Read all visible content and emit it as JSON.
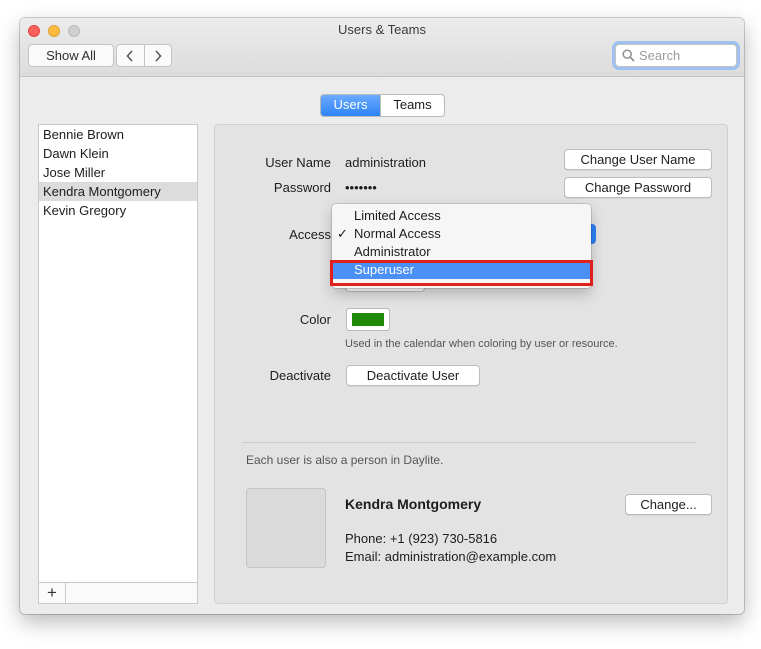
{
  "window": {
    "title": "Users & Teams"
  },
  "toolbar": {
    "show_all_label": "Show All",
    "back_icon": "chevron-left-icon",
    "forward_icon": "chevron-right-icon",
    "search_placeholder": "Search"
  },
  "tabs": [
    {
      "label": "Users",
      "selected": true
    },
    {
      "label": "Teams",
      "selected": false
    }
  ],
  "users": [
    {
      "name": "Bennie Brown"
    },
    {
      "name": "Dawn Klein"
    },
    {
      "name": "Jose Miller"
    },
    {
      "name": "Kendra Montgomery",
      "selected": true
    },
    {
      "name": "Kevin Gregory"
    }
  ],
  "list_footer": {
    "add_label": "+"
  },
  "form": {
    "user_name_label": "User Name",
    "user_name_value": "administration",
    "change_user_name_label": "Change User Name",
    "password_label": "Password",
    "password_value": "•••••••",
    "change_password_label": "Change Password",
    "access_label": "Access",
    "advanced_label": "Advanced...",
    "color_label": "Color",
    "color_value": "#1e8a06",
    "color_hint": "Used in the calendar when coloring by user or resource.",
    "deactivate_label": "Deactivate",
    "deactivate_button_label": "Deactivate User"
  },
  "access_menu": {
    "items": [
      {
        "label": "Limited Access",
        "checked": false,
        "highlighted": false
      },
      {
        "label": "Normal Access",
        "checked": true,
        "highlighted": false
      },
      {
        "label": "Administrator",
        "checked": false,
        "highlighted": false
      },
      {
        "label": "Superuser",
        "checked": false,
        "highlighted": true
      }
    ],
    "check_glyph": "✓"
  },
  "person": {
    "note": "Each user is also a person in Daylite.",
    "name": "Kendra Montgomery",
    "change_label": "Change...",
    "phone": "Phone: +1 (923) 730-5816",
    "email": "Email: administration@example.com"
  }
}
